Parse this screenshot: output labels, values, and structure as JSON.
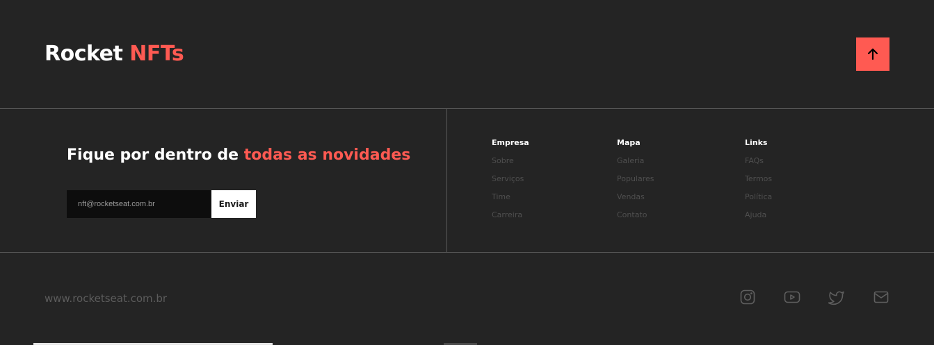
{
  "brand": {
    "name": "Rocket",
    "accent": "NFTs"
  },
  "scroll_top": {
    "icon": "arrow-up-icon"
  },
  "newsletter": {
    "title_start": "Fique por dentro de ",
    "title_accent": "todas as novidades",
    "input_placeholder": "nft@rocketseat.com.br",
    "submit_label": "Enviar"
  },
  "columns": [
    {
      "title": "Empresa",
      "links": [
        "Sobre",
        "Serviços",
        "Time",
        "Carreira"
      ]
    },
    {
      "title": "Mapa",
      "links": [
        "Galeria",
        "Populares",
        "Vendas",
        "Contato"
      ]
    },
    {
      "title": "Links",
      "links": [
        "FAQs",
        "Termos",
        "Política",
        "Ajuda"
      ]
    }
  ],
  "footer": {
    "site_url": "www.rocketseat.com.br",
    "social": [
      {
        "icon": "instagram-icon"
      },
      {
        "icon": "youtube-icon"
      },
      {
        "icon": "twitter-icon"
      },
      {
        "icon": "mail-icon"
      }
    ]
  },
  "colors": {
    "background": "#242424",
    "accent": "#ff5a52",
    "divider": "#5a5a5a",
    "muted_link": "#4f4f4f"
  }
}
